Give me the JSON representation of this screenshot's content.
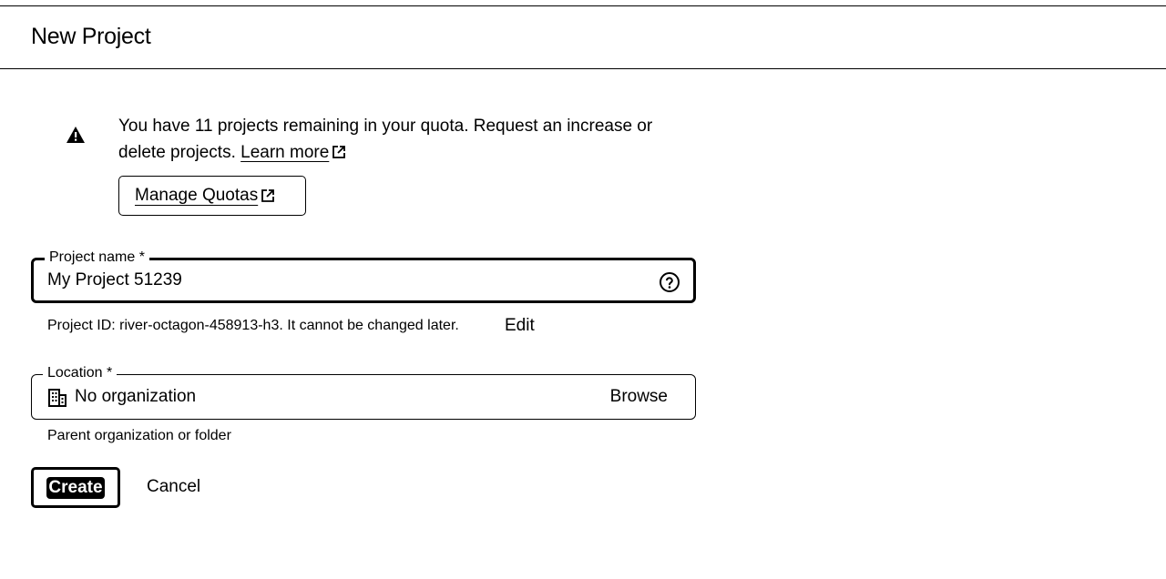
{
  "header": {
    "title": "New Project"
  },
  "quota_notice": {
    "icon": "warning-icon",
    "message": "You have 11 projects remaining in your quota. Request an increase or delete projects.",
    "learn_more_label": "Learn more",
    "manage_quotas_label": "Manage Quotas"
  },
  "project_name": {
    "label": "Project name *",
    "value": "My Project 51239",
    "help_icon": "help-circle-icon"
  },
  "project_id": {
    "text": "Project ID: river-octagon-458913-h3. It cannot be changed later.",
    "edit_label": "Edit"
  },
  "location": {
    "label": "Location *",
    "value": "No organization",
    "icon": "building-icon",
    "browse_label": "Browse",
    "hint": "Parent organization or folder"
  },
  "actions": {
    "create_label": "Create",
    "cancel_label": "Cancel"
  }
}
